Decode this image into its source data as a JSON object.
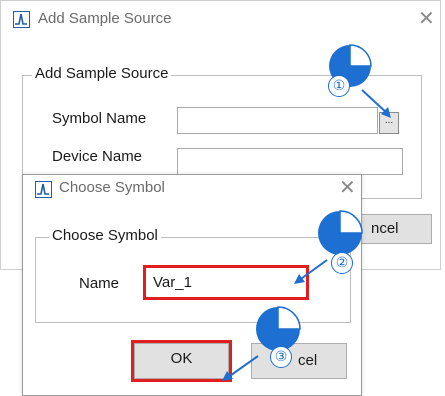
{
  "outer_dialog": {
    "title": "Add Sample Source",
    "group_title": "Add Sample Source",
    "symbol_name_label": "Symbol Name",
    "symbol_name_value": "",
    "browse_button_label": "...",
    "device_name_label": "Device Name",
    "device_name_value": "",
    "cancel_button_partial": "ncel"
  },
  "inner_dialog": {
    "title": "Choose Symbol",
    "group_title": "Choose Symbol",
    "name_label": "Name",
    "name_value": "Var_1",
    "ok_button_label": "OK",
    "cancel_button_partial": "cel"
  },
  "callouts": [
    "①",
    "②",
    "③"
  ],
  "colors": {
    "accent": "#1d6fd1",
    "highlight": "#e0201f",
    "icon": "#1f5fa8"
  },
  "icons": {
    "app_icon": "waveform-icon",
    "close": "close-icon"
  }
}
